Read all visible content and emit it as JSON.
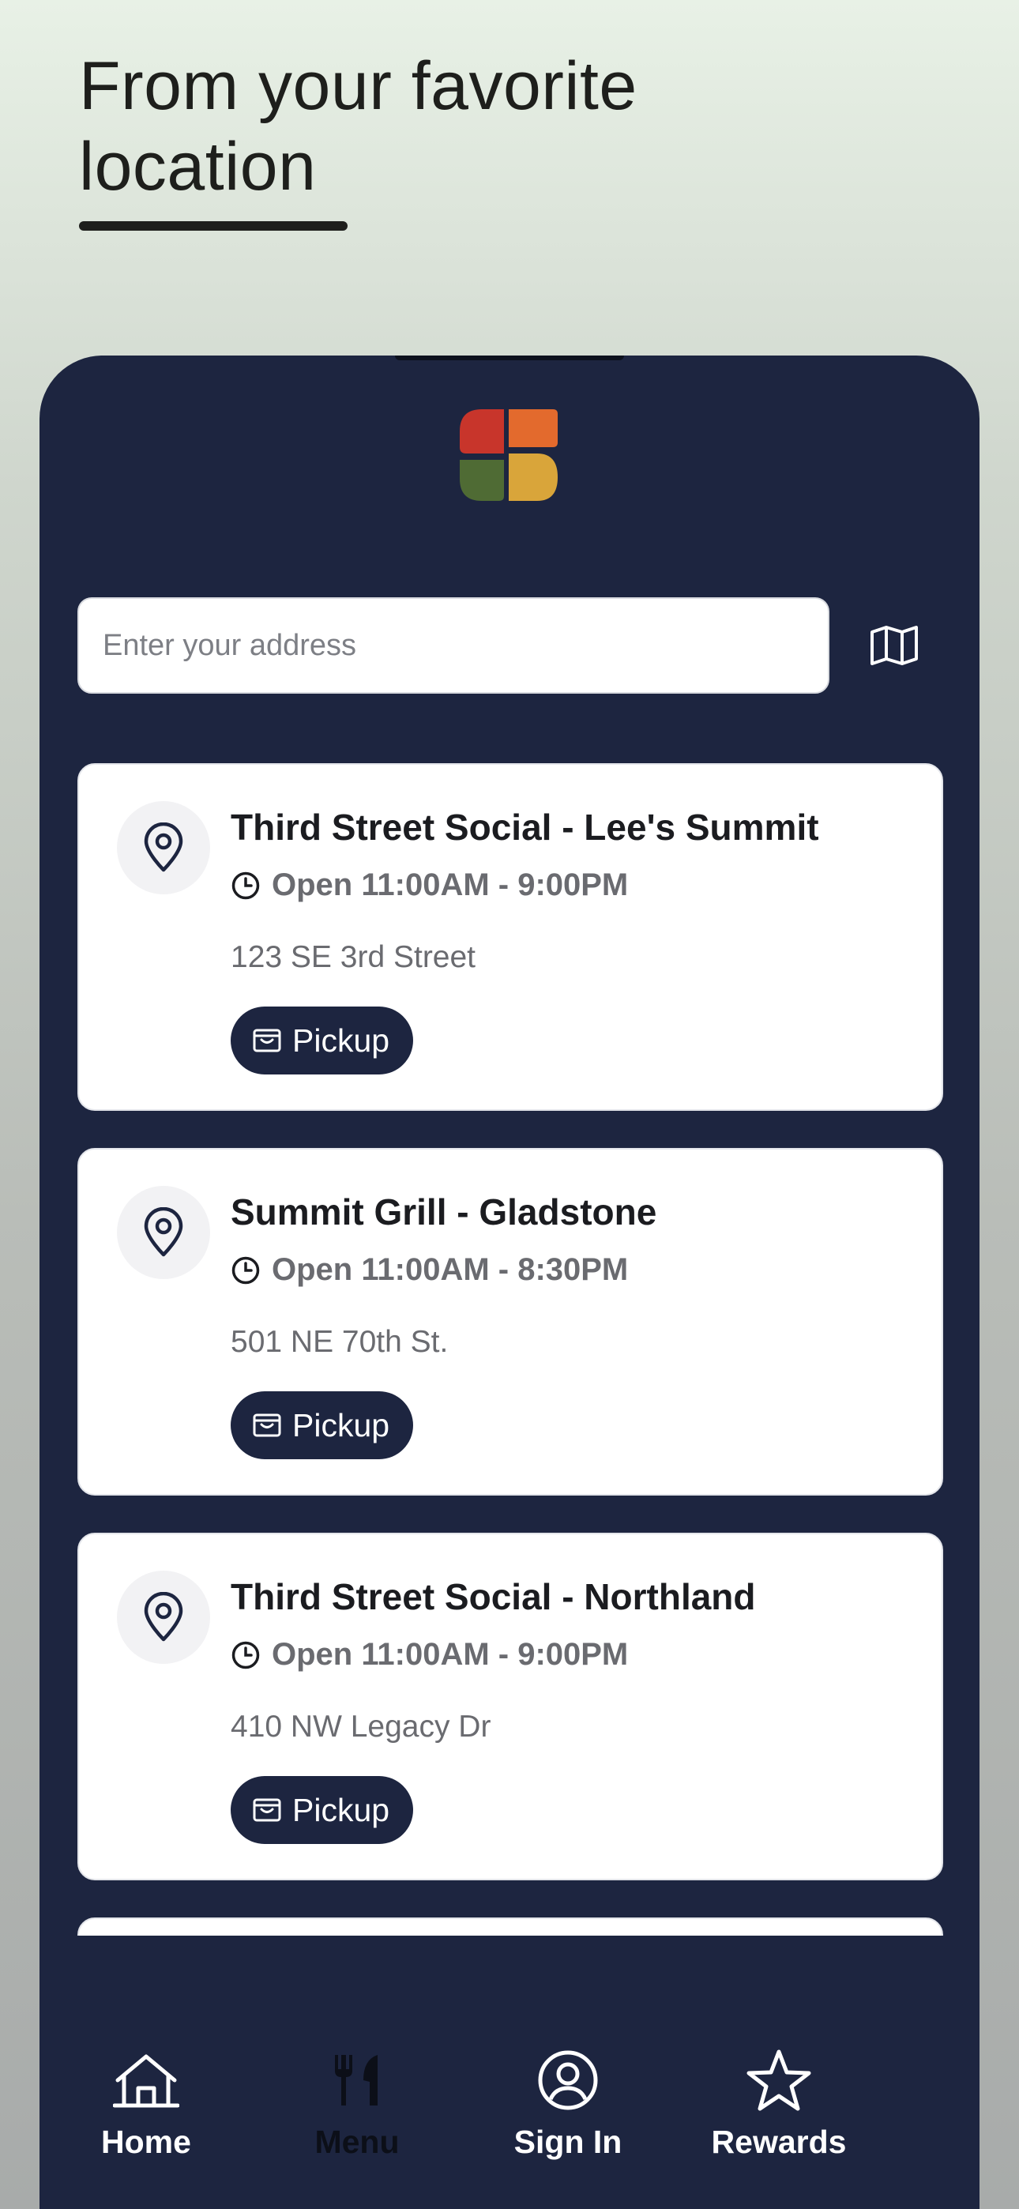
{
  "promo": {
    "headline_line1": "From your favorite",
    "headline_line2": "location"
  },
  "app": {
    "brand_colors": [
      "#c8352b",
      "#e36a2d",
      "#4f6b34",
      "#d9a53a"
    ],
    "background": "#1d2540"
  },
  "search": {
    "placeholder": "Enter your address",
    "value": ""
  },
  "map_button": {
    "icon": "map-icon"
  },
  "locations": [
    {
      "name": "Third Street Social - Lee's Summit",
      "hours": "Open 11:00AM - 9:00PM",
      "address": "123 SE 3rd Street",
      "action": "Pickup"
    },
    {
      "name": "Summit Grill - Gladstone",
      "hours": "Open 11:00AM - 8:30PM",
      "address": "501 NE 70th St.",
      "action": "Pickup"
    },
    {
      "name": "Third Street Social - Northland",
      "hours": "Open 11:00AM - 9:00PM",
      "address": "410 NW Legacy Dr",
      "action": "Pickup"
    }
  ],
  "tabbar": {
    "items": [
      {
        "label": "Home",
        "icon": "home-icon",
        "active": false
      },
      {
        "label": "Menu",
        "icon": "fork-knife-icon",
        "active": true
      },
      {
        "label": "Sign In",
        "icon": "user-circle-icon",
        "active": false
      },
      {
        "label": "Rewards",
        "icon": "star-icon",
        "active": false
      }
    ]
  }
}
